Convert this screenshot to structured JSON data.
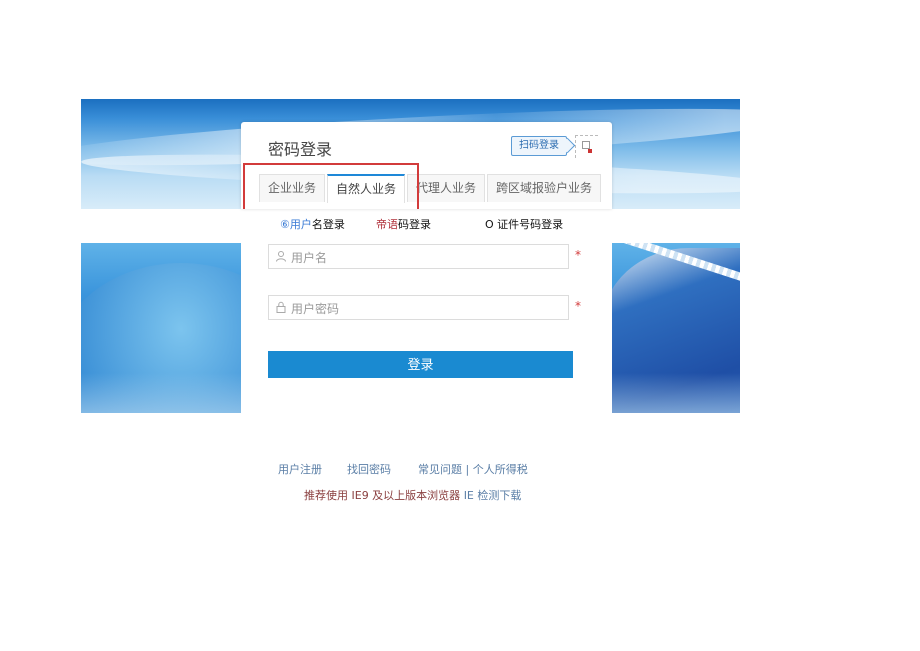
{
  "login_card": {
    "title": "密码登录",
    "qr_login_label": "扫码登录",
    "tabs": [
      {
        "label": "企业业务",
        "active": false
      },
      {
        "label": "自然人业务",
        "active": true
      },
      {
        "label": "代理人业务",
        "active": false
      },
      {
        "label": "跨区域报验户业务",
        "active": false
      }
    ]
  },
  "login_options": {
    "user_prefix": "⑥用户",
    "user_suffix": "名登录",
    "phone_prefix": "帝语",
    "phone_suffix": "码登录",
    "cert": "O 证件号码登录"
  },
  "form": {
    "username_placeholder": "用户名",
    "password_placeholder": "用户密码",
    "required_mark": "*",
    "submit_label": "登录"
  },
  "footer": {
    "register": "用户注册",
    "forgot_password": "找回密码",
    "faq": "常见问题 | 个人所得税",
    "browser_note": "推荐使用 IE9 及以上版本浏览器",
    "browser_link": "IE 检测下载"
  },
  "colors": {
    "accent": "#1a8ad1",
    "highlight_border": "#d23b3b"
  },
  "icons": {
    "username": "user-icon",
    "password": "lock-icon",
    "qr": "qr-code-icon"
  }
}
